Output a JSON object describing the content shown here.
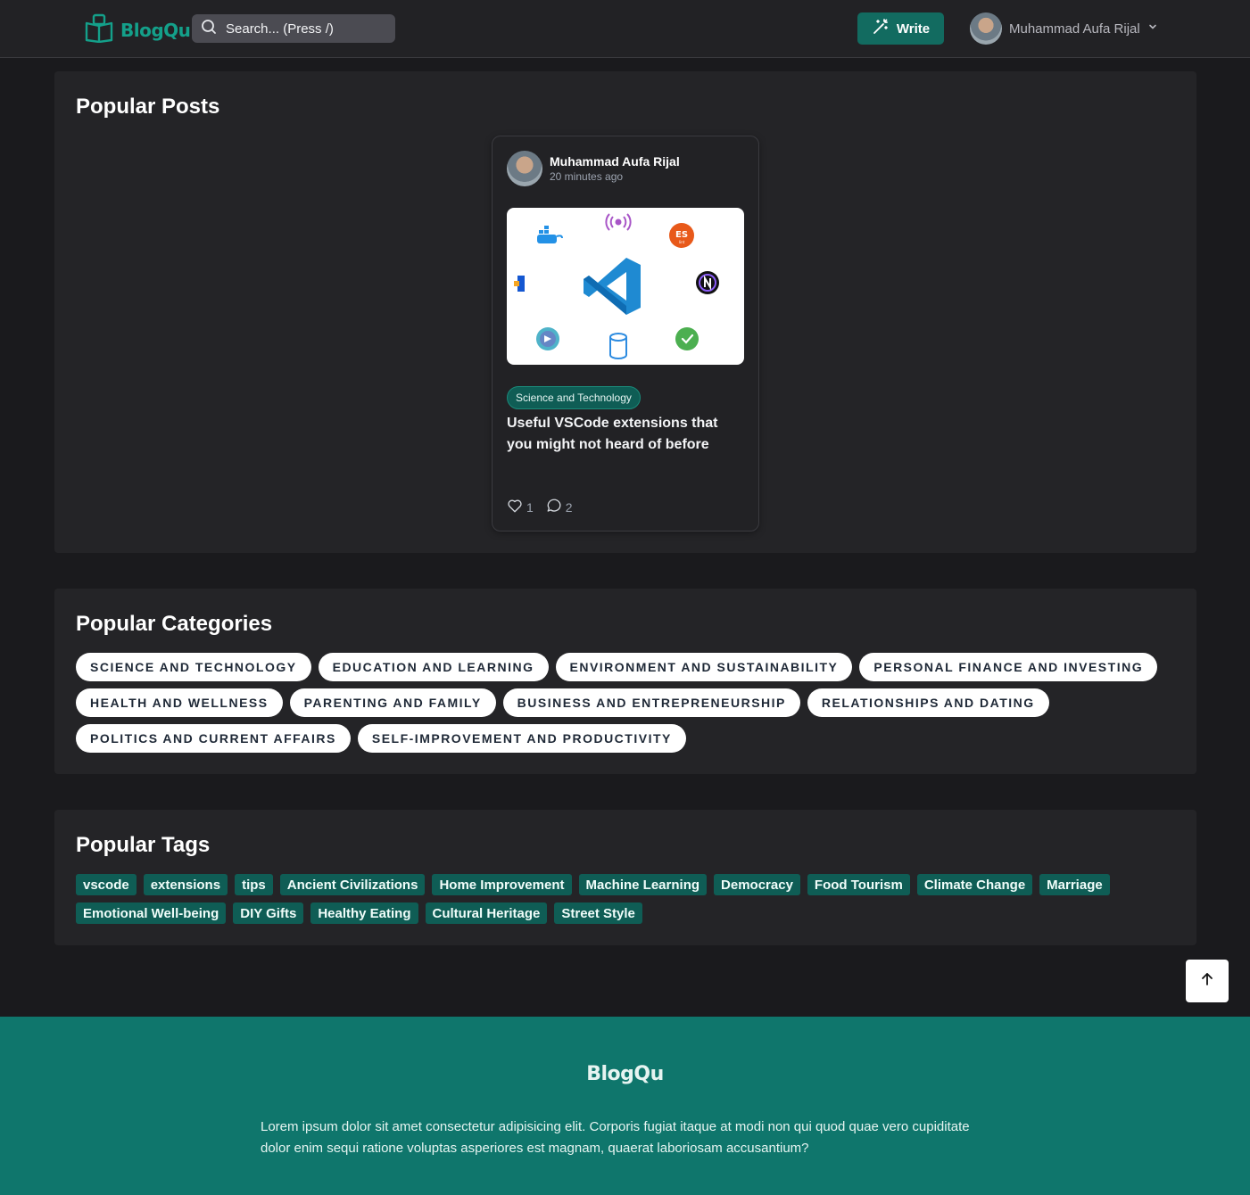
{
  "header": {
    "logo_text": "BlogQu",
    "search_placeholder": "Search... (Press /)",
    "write_label": "Write",
    "user_name": "Muhammad Aufa Rijal"
  },
  "popular_posts": {
    "title": "Popular Posts",
    "posts": [
      {
        "author": "Muhammad Aufa Rijal",
        "time": "20 minutes ago",
        "category": "Science and Technology",
        "title": "Useful VSCode extensions that you might not heard of before",
        "likes": "1",
        "comments": "2"
      }
    ]
  },
  "popular_categories": {
    "title": "Popular Categories",
    "items": [
      "SCIENCE AND TECHNOLOGY",
      "EDUCATION AND LEARNING",
      "ENVIRONMENT AND SUSTAINABILITY",
      "PERSONAL FINANCE AND INVESTING",
      "HEALTH AND WELLNESS",
      "PARENTING AND FAMILY",
      "BUSINESS AND ENTREPRENEURSHIP",
      "RELATIONSHIPS AND DATING",
      "POLITICS AND CURRENT AFFAIRS",
      "SELF-IMPROVEMENT AND PRODUCTIVITY"
    ]
  },
  "popular_tags": {
    "title": "Popular Tags",
    "items": [
      "vscode",
      "extensions",
      "tips",
      "Ancient Civilizations",
      "Home Improvement",
      "Machine Learning",
      "Democracy",
      "Food Tourism",
      "Climate Change",
      "Marriage",
      "Emotional Well-being",
      "DIY Gifts",
      "Healthy Eating",
      "Cultural Heritage",
      "Street Style"
    ]
  },
  "footer": {
    "brand": "BlogQu",
    "text": "Lorem ipsum dolor sit amet consectetur adipisicing elit. Corporis fugiat itaque at modi non qui quod quae vero cupiditate dolor enim sequi ratione voluptas asperiores est magnam, quaerat laboriosam accusantium?"
  },
  "colors": {
    "accent": "#126b60",
    "brand": "#14a08a",
    "footer_bg": "#0f766c",
    "page_bg": "#1a1a1d",
    "panel_bg": "#242427"
  }
}
